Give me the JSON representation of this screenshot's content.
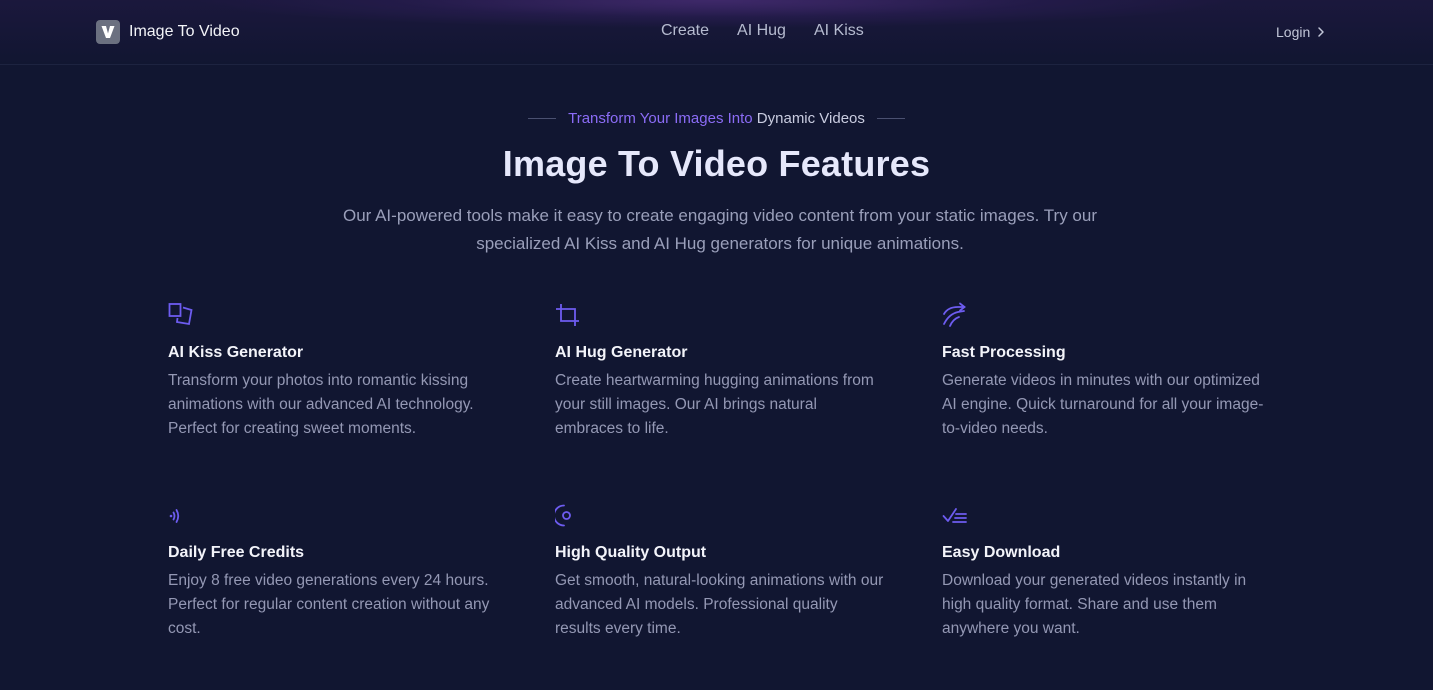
{
  "header": {
    "logo_letter": "V",
    "logo_text": "Image To Video",
    "nav": [
      "Create",
      "AI Hug",
      "AI Kiss"
    ],
    "login_label": "Login"
  },
  "hero": {
    "eyebrow_part1": "Transform Your Images Into ",
    "eyebrow_part2": "Dynamic Videos",
    "title": "Image To Video Features",
    "subtitle": "Our AI-powered tools make it easy to create engaging video content from your static images. Try our specialized AI Kiss and AI Hug generators for unique animations."
  },
  "features": [
    {
      "icon": "crop-frame-icon",
      "title": "AI Kiss Generator",
      "description": "Transform your photos into romantic kissing animations with our advanced AI technology. Perfect for creating sweet moments."
    },
    {
      "icon": "crop-icon",
      "title": "AI Hug Generator",
      "description": "Create heartwarming hugging animations from your still images. Our AI brings natural embraces to life."
    },
    {
      "icon": "fast-forward-arrows-icon",
      "title": "Fast Processing",
      "description": "Generate videos in minutes with our optimized AI engine. Quick turnaround for all your image-to-video needs."
    },
    {
      "icon": "signal-waves-icon",
      "title": "Daily Free Credits",
      "description": "Enjoy 8 free video generations every 24 hours. Perfect for regular content creation without any cost."
    },
    {
      "icon": "quality-dial-icon",
      "title": "High Quality Output",
      "description": "Get smooth, natural-looking animations with our advanced AI models. Professional quality results every time."
    },
    {
      "icon": "checklist-icon",
      "title": "Easy Download",
      "description": "Download your generated videos instantly in high quality format. Share and use them anywhere you want."
    }
  ],
  "colors": {
    "background": "#111631",
    "accent": "#6d5cf0",
    "eyebrow_accent": "#8b6cf6",
    "heading": "#e6e8fb",
    "body_text": "#9498b4"
  }
}
